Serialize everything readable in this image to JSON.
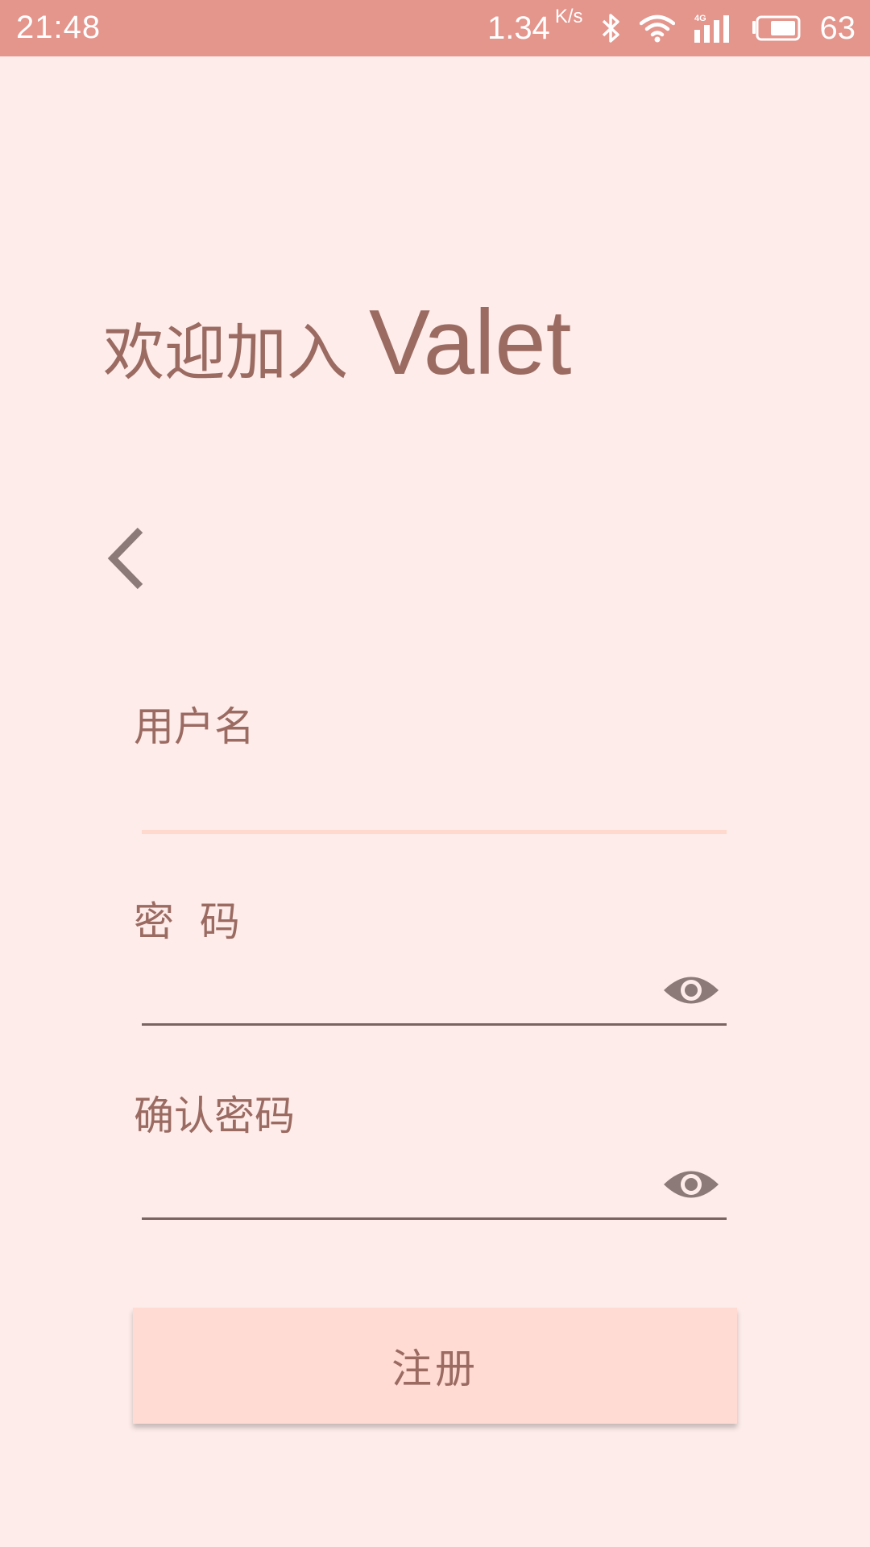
{
  "status_bar": {
    "time": "21:48",
    "network_speed": "1.34",
    "network_speed_unit": "K/s",
    "battery_level": "63",
    "icons": [
      "bluetooth-icon",
      "wifi-icon",
      "4g-signal-icon",
      "battery-icon"
    ],
    "network_label": "4G"
  },
  "welcome": {
    "text": "欢迎加入",
    "brand": "Valet"
  },
  "form": {
    "username_label": "用户名",
    "password_label": "密  码",
    "confirm_password_label": "确认密码"
  },
  "register_button": "注册",
  "colors": {
    "status_bar": "#e4958c",
    "background": "#fdecea",
    "text": "#9b6b62",
    "button": "#ffdbd3",
    "active_underline": "#ffd9cd",
    "underline": "#7a6461",
    "icon": "#8c7a79"
  }
}
